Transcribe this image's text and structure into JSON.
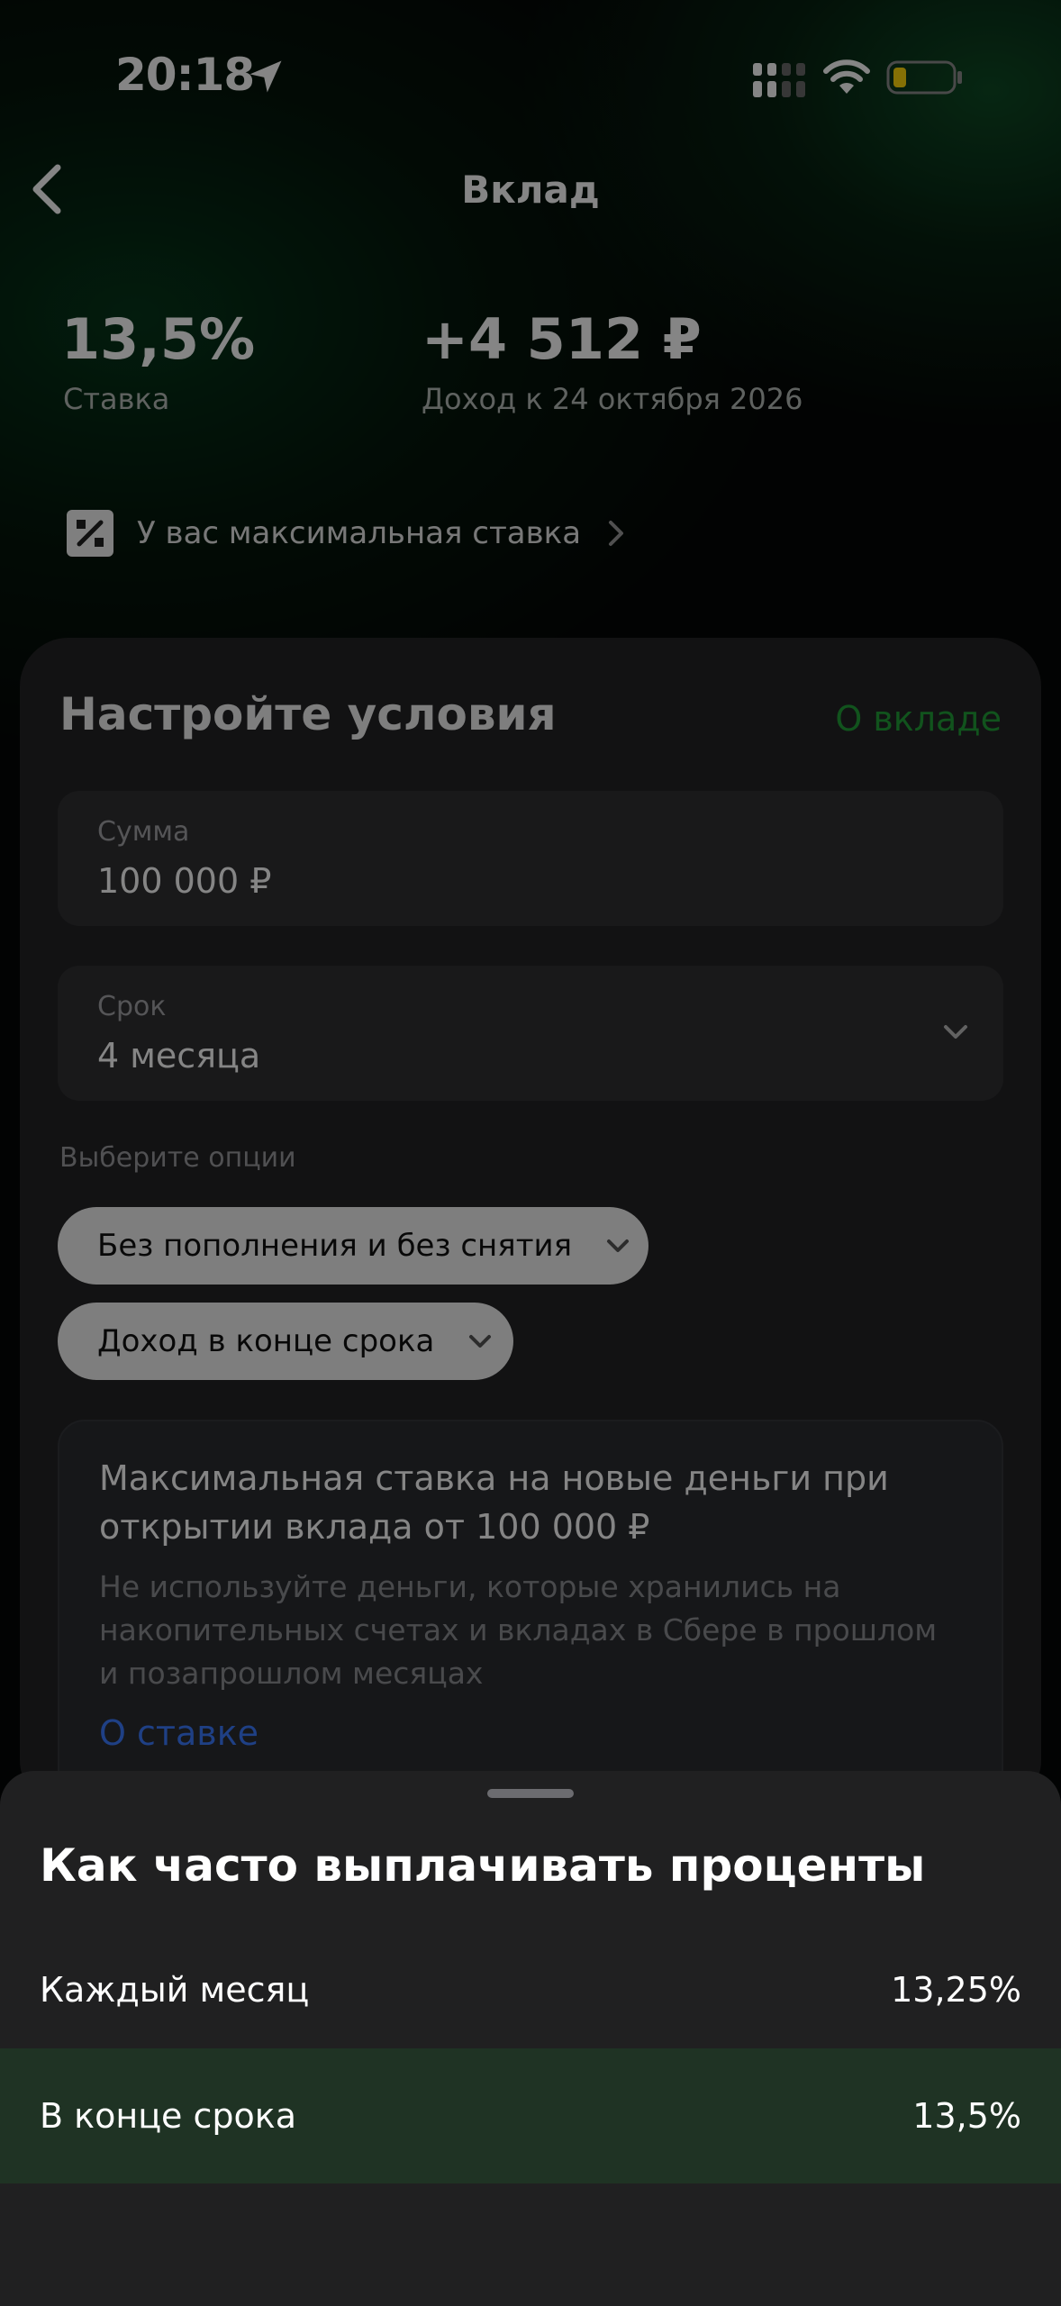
{
  "status_bar": {
    "time": "20:18"
  },
  "nav": {
    "title": "Вклад"
  },
  "summary": {
    "rate_value": "13,5%",
    "rate_label": "Ставка",
    "income_value": "+4 512 ₽",
    "income_label": "Доход к 24 октября 2026"
  },
  "promo": {
    "text": "У вас максимальная ставка"
  },
  "card": {
    "title": "Настройте условия",
    "about_link": "О вкладе",
    "amount": {
      "label": "Сумма",
      "value": "100 000 ₽"
    },
    "term": {
      "label": "Срок",
      "value": "4 месяца"
    },
    "options_label": "Выберите опции",
    "option_chips": [
      "Без пополнения и без снятия",
      "Доход в конце срока"
    ],
    "info": {
      "title": "Максимальная ставка на новые деньги при открытии вклада от 100 000 ₽",
      "description": "Не используйте деньги, которые хранились на накопительных счетах и вкладах в Сбере в прошлом и позапрошлом месяцах",
      "link": "О ставке"
    }
  },
  "sheet": {
    "title": "Как часто выплачивать проценты",
    "options": [
      {
        "label": "Каждый месяц",
        "rate": "13,25%",
        "selected": false
      },
      {
        "label": "В конце срока",
        "rate": "13,5%",
        "selected": true
      }
    ]
  },
  "colors": {
    "accent_green": "#21a038",
    "link_blue": "#3d7bff",
    "selected_row": "#1f3324"
  },
  "icons": [
    "location-arrow-icon",
    "signal-icon",
    "wifi-icon",
    "battery-icon",
    "chevron-left-icon",
    "percent-icon",
    "chevron-right-icon",
    "chevron-down-icon"
  ]
}
